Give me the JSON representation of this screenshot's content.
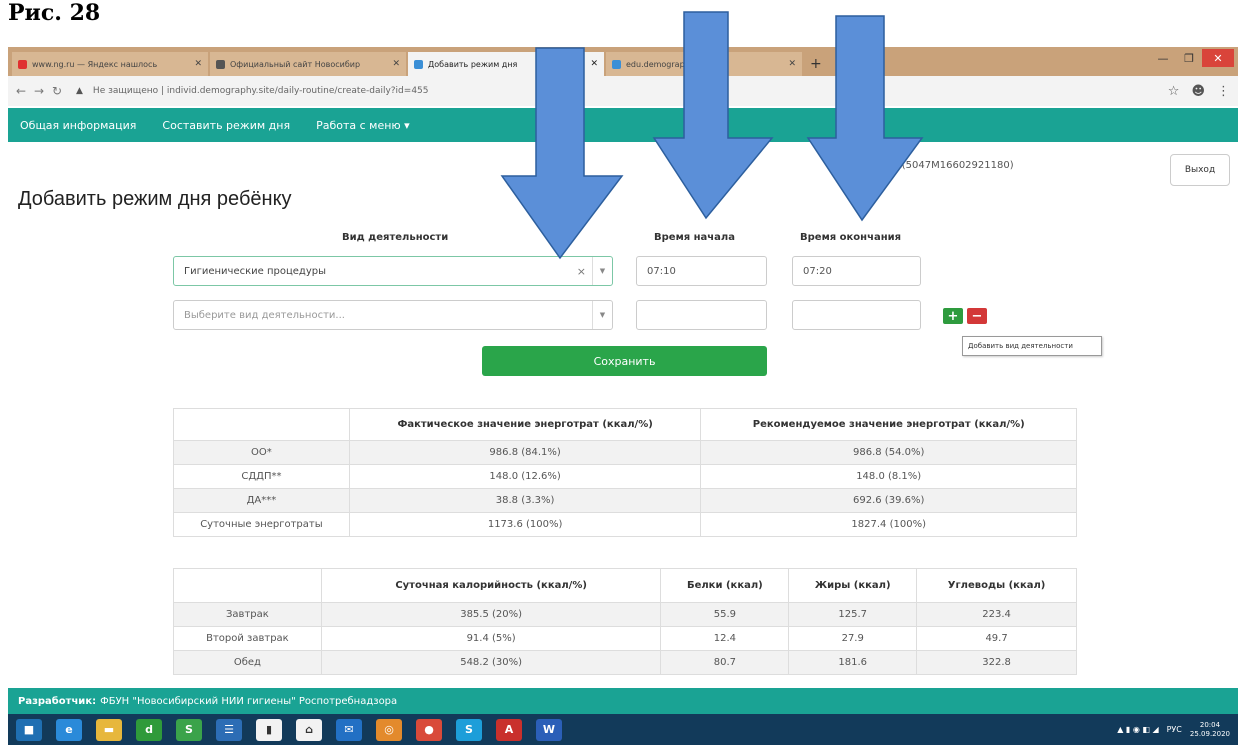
{
  "figure_label": "Рис. 28",
  "browser": {
    "tabs": [
      {
        "title": "www.ng.ru — Яндекс нашлось",
        "fav_color": "#e03030",
        "active": false
      },
      {
        "title": "Официальный сайт Новосибир",
        "fav_color": "#555555",
        "active": false
      },
      {
        "title": "Добавить режим дня",
        "fav_color": "#3b8fd6",
        "active": true
      },
      {
        "title": "edu.demography",
        "fav_color": "#3b8fd6",
        "active": false
      }
    ],
    "new_tab": "+",
    "url": "Не защищено | individ.demography.site/daily-routine/create-daily?id=455",
    "url_warning": "▲"
  },
  "nav": {
    "items": [
      "Общая информация",
      "Составить режим дня",
      "Работа с меню ▾"
    ]
  },
  "user_info": "Пол...............к(5047М16602921180)",
  "logout_label": "Выход",
  "page_title": "Добавить режим дня ребёнку",
  "form": {
    "col_activity": "Вид деятельности",
    "col_start": "Время начала",
    "col_end": "Время окончания",
    "row1_activity": "Гигиенические процедуры",
    "row1_start": "07:10",
    "row1_end": "07:20",
    "row2_placeholder": "Выберите вид деятельности...",
    "clear_icon": "×",
    "caret_icon": "▼",
    "add_icon": "+",
    "remove_icon": "−",
    "tooltip": "Добавить вид деятельности",
    "save_label": "Сохранить"
  },
  "energy_table": {
    "headers": [
      "",
      "Фактическое значение энерготрат (ккал/%)",
      "Рекомендуемое значение энерготрат (ккал/%)"
    ],
    "rows": [
      [
        "ОО*",
        "986.8 (84.1%)",
        "986.8 (54.0%)"
      ],
      [
        "СДДП**",
        "148.0 (12.6%)",
        "148.0 (8.1%)"
      ],
      [
        "ДА***",
        "38.8 (3.3%)",
        "692.6 (39.6%)"
      ],
      [
        "Суточные энерготраты",
        "1173.6 (100%)",
        "1827.4 (100%)"
      ]
    ]
  },
  "meal_table": {
    "headers": [
      "",
      "Суточная калорийность (ккал/%)",
      "Белки (ккал)",
      "Жиры (ккал)",
      "Углеводы (ккал)"
    ],
    "rows": [
      [
        "Завтрак",
        "385.5 (20%)",
        "55.9",
        "125.7",
        "223.4"
      ],
      [
        "Второй завтрак",
        "91.4 (5%)",
        "12.4",
        "27.9",
        "49.7"
      ],
      [
        "Обед",
        "548.2 (30%)",
        "80.7",
        "181.6",
        "322.8"
      ]
    ]
  },
  "footer": {
    "label": "Разработчик:",
    "text": "ФБУН \"Новосибирский НИИ гигиены\" Роспотребнадзора"
  },
  "taskbar": {
    "icons": [
      {
        "name": "start-icon",
        "color": "#1f6fb2",
        "glyph": "■"
      },
      {
        "name": "ie-icon",
        "color": "#2a8ad9",
        "glyph": "e"
      },
      {
        "name": "folder-icon",
        "color": "#e7b73c",
        "glyph": "▬"
      },
      {
        "name": "store-icon",
        "color": "#2f9a3a",
        "glyph": "d"
      },
      {
        "name": "skype-icon",
        "color": "#3aa34a",
        "glyph": "S"
      },
      {
        "name": "monitor-icon",
        "color": "#2c6db5",
        "glyph": "☰"
      },
      {
        "name": "file-icon",
        "color": "#f2f2f2",
        "glyph": "▮"
      },
      {
        "name": "home-icon",
        "color": "#f2f2f2",
        "glyph": "⌂"
      },
      {
        "name": "mail-icon",
        "color": "#2270c4",
        "glyph": "✉"
      },
      {
        "name": "avast-icon",
        "color": "#e38a2c",
        "glyph": "◎"
      },
      {
        "name": "chrome-icon",
        "color": "#d94a3a",
        "glyph": "●"
      },
      {
        "name": "skype2-icon",
        "color": "#1d9ed9",
        "glyph": "S"
      },
      {
        "name": "acrobat-icon",
        "color": "#c9302c",
        "glyph": "A"
      },
      {
        "name": "word-icon",
        "color": "#2b5fb8",
        "glyph": "W"
      }
    ],
    "lang": "РУС",
    "time": "20:04",
    "date": "25.09.2020"
  },
  "arrow_color": "#5b8fd8"
}
